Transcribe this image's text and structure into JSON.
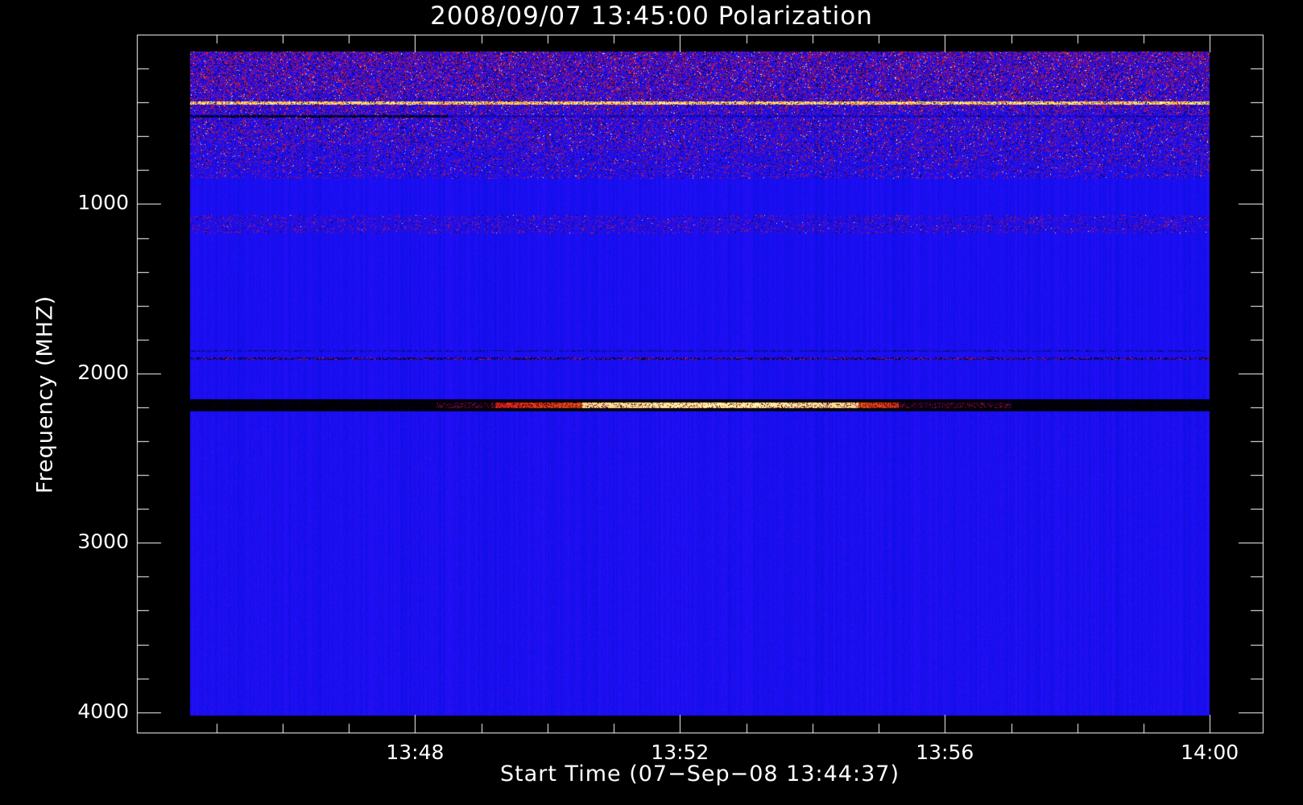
{
  "chart_data": {
    "type": "heatmap",
    "title": "2008/09/07 13:45:00 Polarization",
    "xlabel": "Start Time (07−Sep−08 13:44:37)",
    "ylabel": "Frequency (MHZ)",
    "x_ticks": [
      "13:48",
      "13:52",
      "13:56",
      "14:00"
    ],
    "y_ticks": [
      "1000",
      "2000",
      "3000",
      "4000"
    ],
    "x_tick_minutes": [
      48,
      52,
      56,
      60
    ],
    "y_tick_values": [
      1000,
      2000,
      3000,
      4000
    ],
    "x_range_minutes": [
      44.6,
      60.0
    ],
    "x_axis_range_minutes": [
      43.8,
      60.8
    ],
    "y_range": [
      100,
      4020
    ],
    "y_axis_range": [
      0,
      4120
    ],
    "y_inverted": true,
    "grid": false,
    "background_color": "#000000",
    "colormap": [
      "#000000",
      "#0000ff",
      "#ff0000",
      "#ffff00",
      "#ffffff"
    ],
    "base_color": "#1a10f0",
    "features": [
      {
        "label": "noisy low-frequency band",
        "freq_range": [
          100,
          850
        ],
        "intensity": "mixed"
      },
      {
        "label": "bright interference line",
        "freq": 400,
        "color": "#ffe060"
      },
      {
        "label": "dark line",
        "freq": 480,
        "color": "#000000"
      },
      {
        "label": "sparse bursts",
        "freq_range": [
          1060,
          1170
        ],
        "intensity": "mixed"
      },
      {
        "label": "dark line",
        "freq": 1910,
        "color": "#000000"
      },
      {
        "label": "dark band",
        "freq_range": [
          2150,
          2220
        ],
        "color": "#000000"
      },
      {
        "label": "polarized emission",
        "freq": 2185,
        "time_range_minutes": [
          49.2,
          55.3
        ],
        "peak_minute": 52.6,
        "color": "#ff8040"
      }
    ]
  }
}
